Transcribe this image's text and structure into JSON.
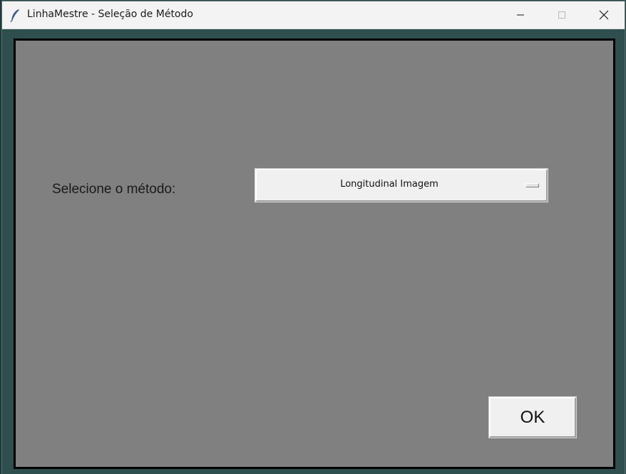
{
  "window": {
    "title": "LinhaMestre - Seleção de Método",
    "app_icon": "feather-icon",
    "controls": {
      "minimize_icon": "minimize-icon",
      "maximize_icon": "maximize-icon",
      "close_icon": "close-icon"
    }
  },
  "form": {
    "method_label": "Selecione o método:",
    "method_select": {
      "selected": "Longitudinal Imagem",
      "indicator_icon": "option-menu-indicator-icon"
    },
    "ok_label": "OK"
  },
  "colors": {
    "client_background": "#808080",
    "window_frame": "#2f4f4f",
    "client_border": "#000000",
    "button_face": "#f0f0f0"
  }
}
